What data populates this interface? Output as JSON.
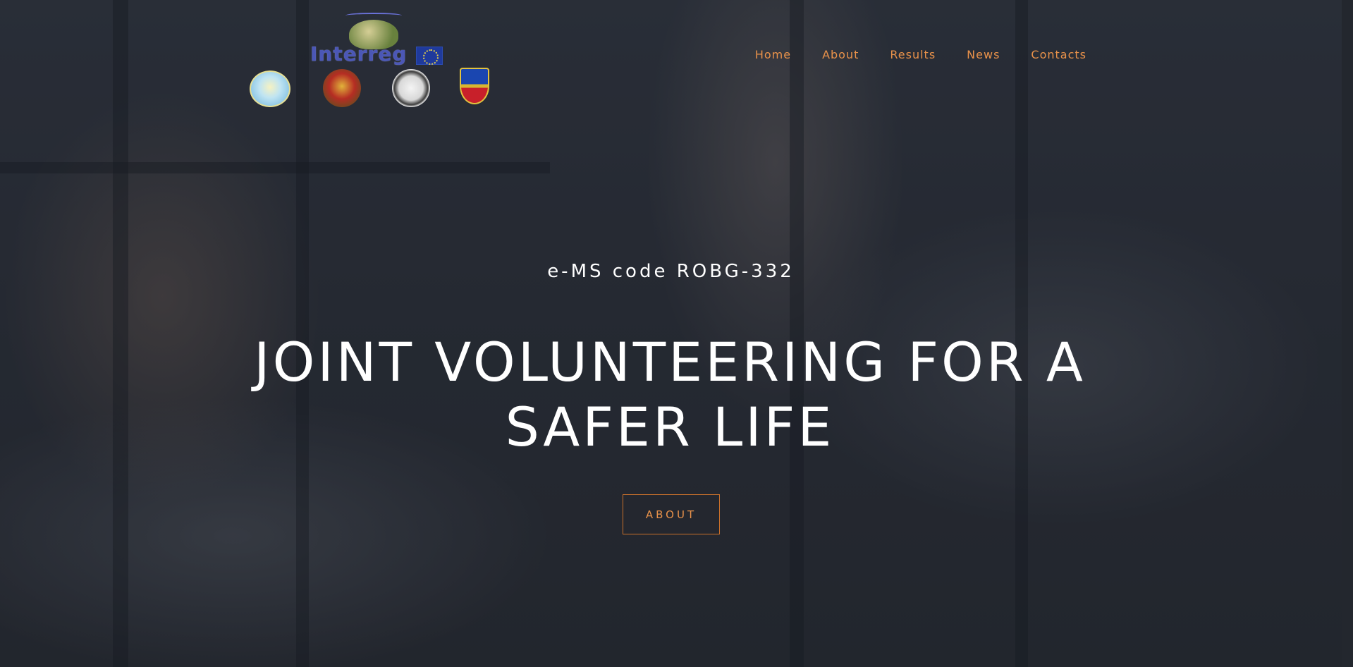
{
  "nav": {
    "items": [
      {
        "label": "Home"
      },
      {
        "label": "About"
      },
      {
        "label": "Results"
      },
      {
        "label": "News"
      },
      {
        "label": "Contacts"
      }
    ]
  },
  "logos": {
    "interreg_word": "Interreg"
  },
  "hero": {
    "subtitle": "e-MS code ROBG-332",
    "title": "JOINT VOLUNTEERING FOR A SAFER LIFE",
    "button_label": "ABOUT"
  },
  "colors": {
    "accent": "#e9924a",
    "overlay": "#2a2f38",
    "text": "#ffffff"
  }
}
